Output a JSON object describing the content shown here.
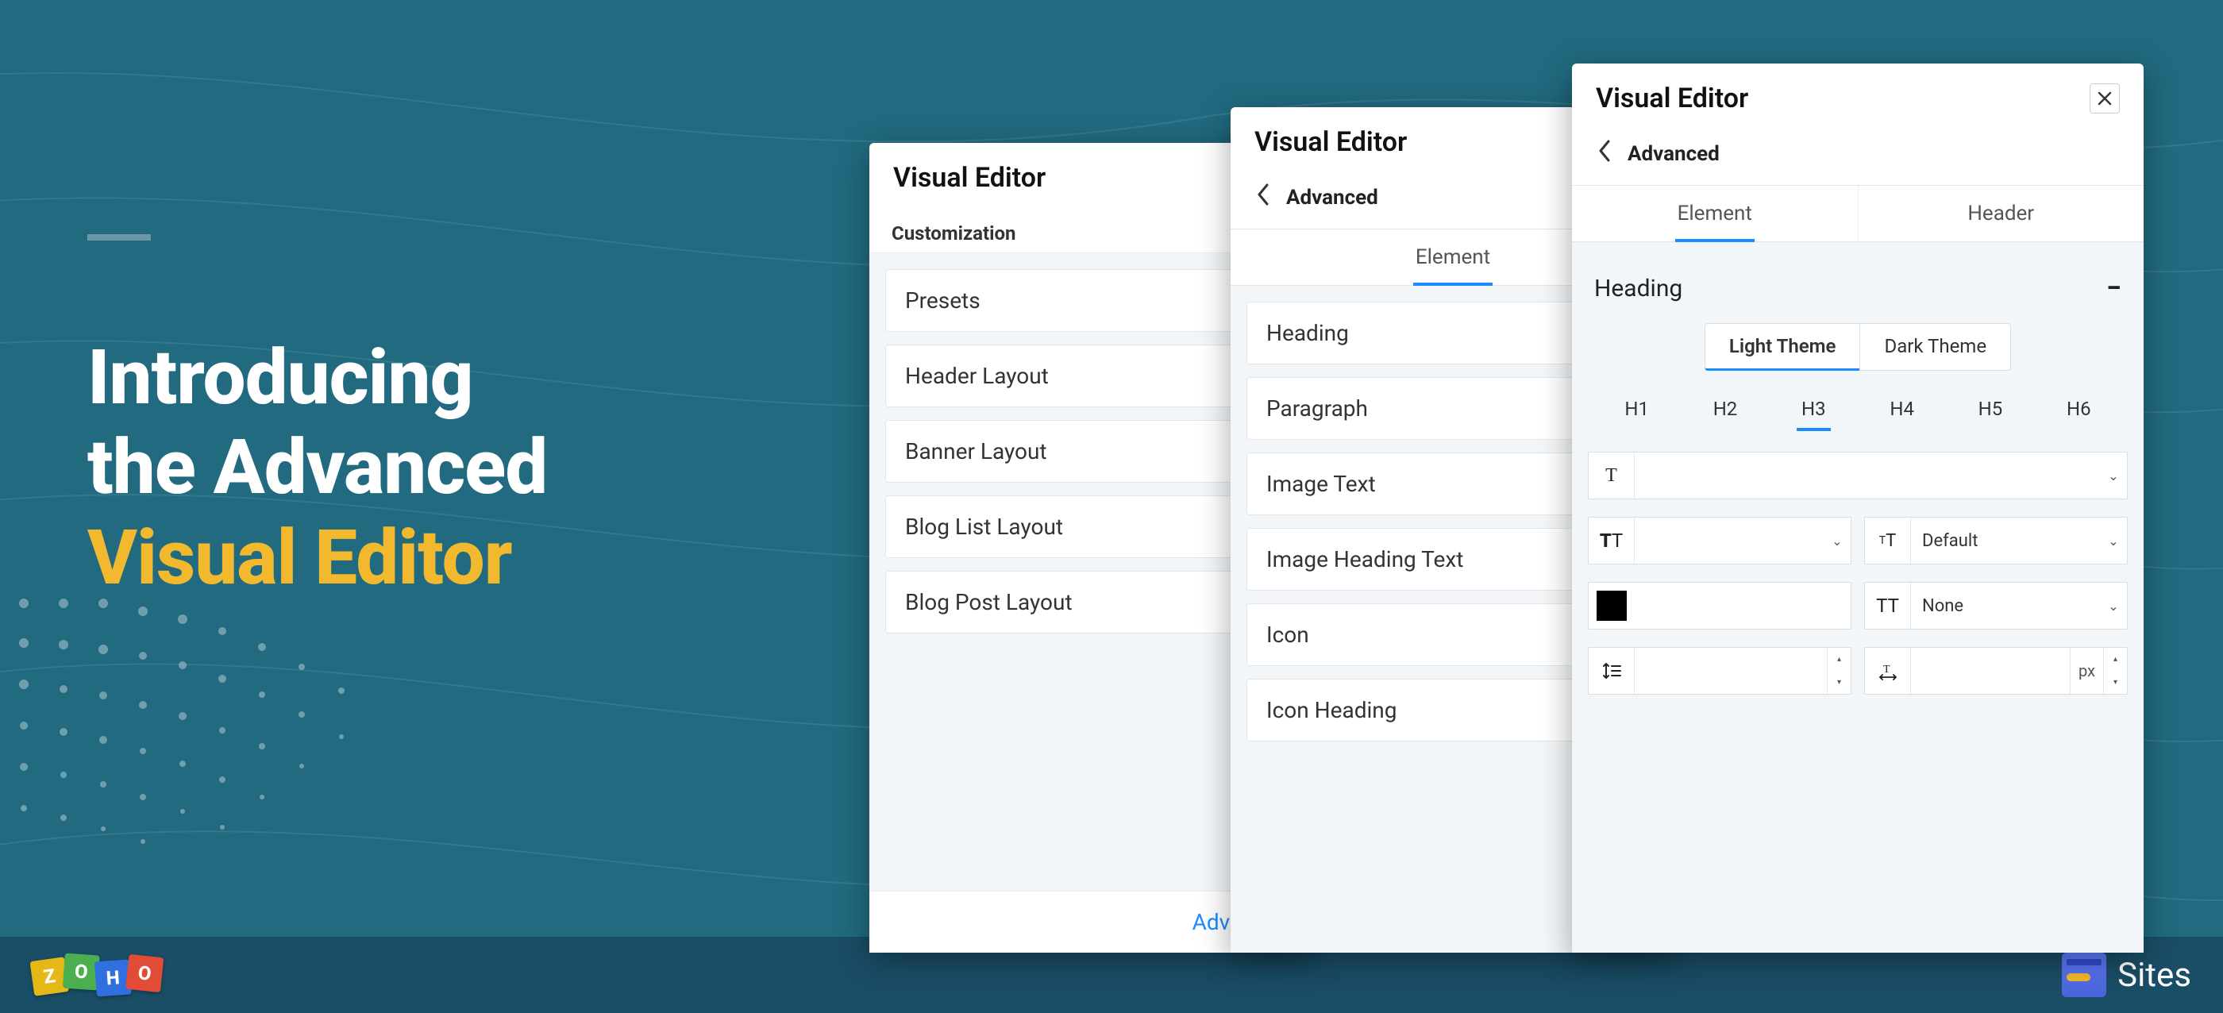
{
  "headline": {
    "line1": "Introducing",
    "line2": "the Advanced",
    "line3": "Visual Editor"
  },
  "panel1": {
    "title": "Visual Editor",
    "section": "Customization",
    "items": [
      "Presets",
      "Header Layout",
      "Banner Layout",
      "Blog List Layout",
      "Blog Post Layout"
    ],
    "footer_link": "Advanced"
  },
  "panel2": {
    "title": "Visual Editor",
    "crumb": "Advanced",
    "tabs": [
      "Element"
    ],
    "active_tab": 0,
    "items": [
      "Heading",
      "Paragraph",
      "Image Text",
      "Image Heading Text",
      "Icon",
      "Icon Heading"
    ]
  },
  "panel3": {
    "title": "Visual Editor",
    "crumb": "Advanced",
    "tabs": [
      "Element",
      "Header"
    ],
    "active_tab": 0,
    "accordion_label": "Heading",
    "themes": [
      "Light Theme",
      "Dark Theme"
    ],
    "active_theme": 0,
    "h_levels": [
      "H1",
      "H2",
      "H3",
      "H4",
      "H5",
      "H6"
    ],
    "active_h_level": 2,
    "font_family_value": "",
    "font_weight_value": "",
    "font_size_label": "Default",
    "text_transform_label": "None",
    "color_value": "#000000",
    "letter_spacing_unit": "px"
  },
  "brand": {
    "zoho_letters": [
      "Z",
      "O",
      "H",
      "O"
    ],
    "sites_label": "Sites"
  }
}
